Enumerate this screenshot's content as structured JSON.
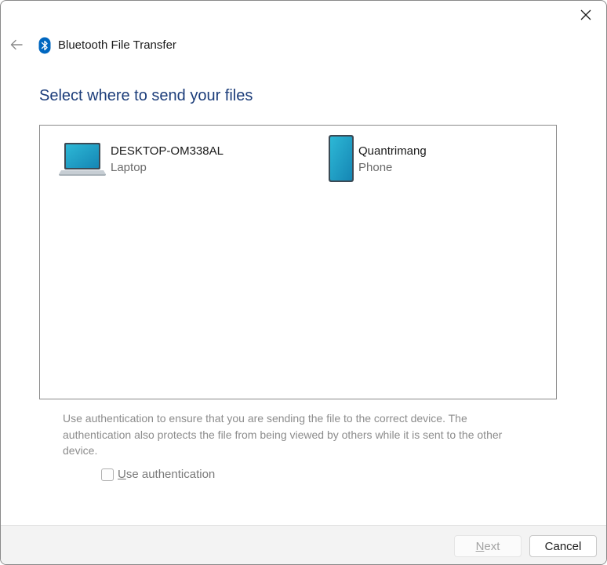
{
  "window": {
    "title": "Bluetooth File Transfer"
  },
  "main": {
    "heading": "Select where to send your files"
  },
  "devices": [
    {
      "name": "DESKTOP-OM338AL",
      "type": "Laptop",
      "icon": "laptop-icon"
    },
    {
      "name": "Quantrimang",
      "type": "Phone",
      "icon": "phone-icon"
    }
  ],
  "auth": {
    "description": "Use authentication to ensure that you are sending the file to the correct device. The authentication also protects the file from being viewed by others while it is sent to the other device.",
    "checkbox_label_first": "U",
    "checkbox_label_rest": "se authentication",
    "checked": false
  },
  "footer": {
    "next_label_first": "N",
    "next_label_rest": "ext",
    "cancel_label": "Cancel"
  },
  "colors": {
    "heading": "#1c3d7a",
    "bluetooth": "#0067c0",
    "device_screen": "#1aa3c4"
  }
}
